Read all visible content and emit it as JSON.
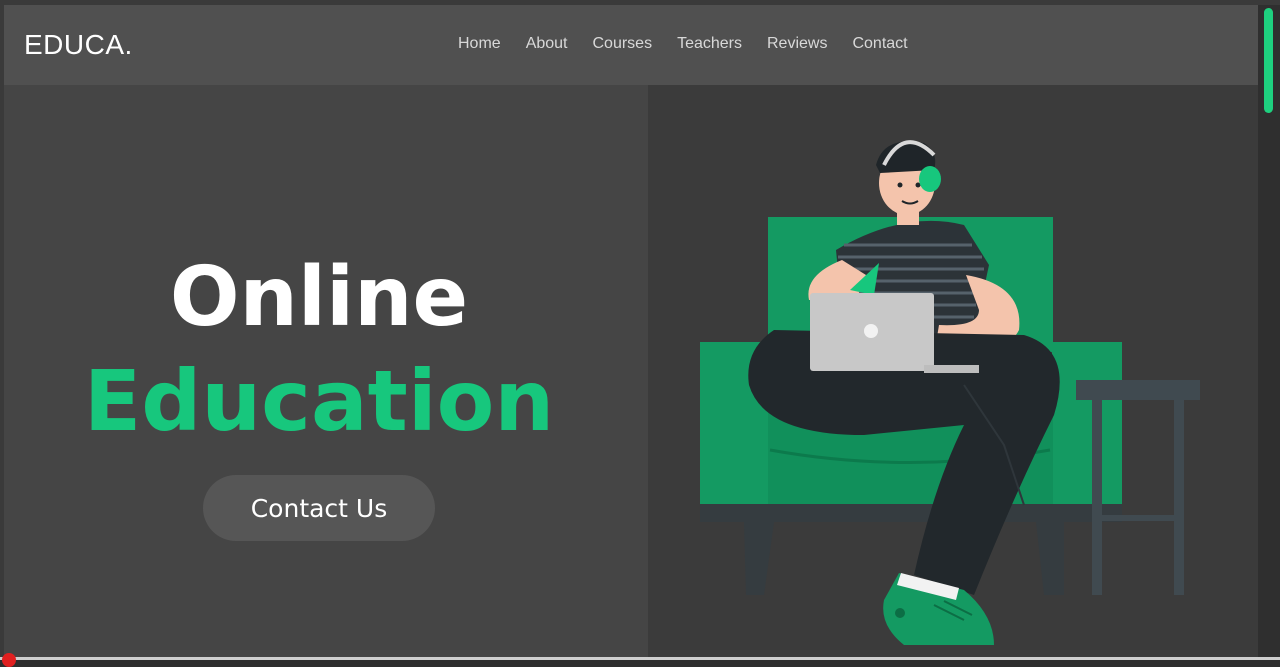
{
  "brand": {
    "logo": "EDUCA."
  },
  "nav": {
    "items": [
      {
        "label": "Home"
      },
      {
        "label": "About"
      },
      {
        "label": "Courses"
      },
      {
        "label": "Teachers"
      },
      {
        "label": "Reviews"
      },
      {
        "label": "Contact"
      }
    ]
  },
  "hero": {
    "title_line1": "Online",
    "title_line2": "Education",
    "cta_label": "Contact Us",
    "illustration": "student-with-laptop-on-sofa-illustration"
  },
  "colors": {
    "accent": "#17c77d",
    "page_background": "#444444",
    "navbar_background": "#505050",
    "sofa": "#149a62"
  }
}
